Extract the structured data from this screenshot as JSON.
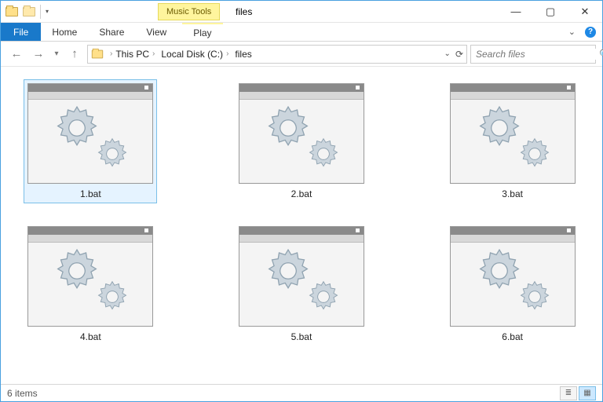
{
  "titlebar": {
    "contextual_tab": "Music Tools",
    "title": "files"
  },
  "ribbon": {
    "file": "File",
    "tabs": {
      "home": "Home",
      "share": "Share",
      "view": "View",
      "play": "Play"
    }
  },
  "breadcrumb": {
    "items": [
      "This PC",
      "Local Disk (C:)",
      "files"
    ]
  },
  "search": {
    "placeholder": "Search files"
  },
  "files": [
    {
      "name": "1.bat",
      "selected": true
    },
    {
      "name": "2.bat",
      "selected": false
    },
    {
      "name": "3.bat",
      "selected": false
    },
    {
      "name": "4.bat",
      "selected": false
    },
    {
      "name": "5.bat",
      "selected": false
    },
    {
      "name": "6.bat",
      "selected": false
    }
  ],
  "status": {
    "count_text": "6 items"
  }
}
